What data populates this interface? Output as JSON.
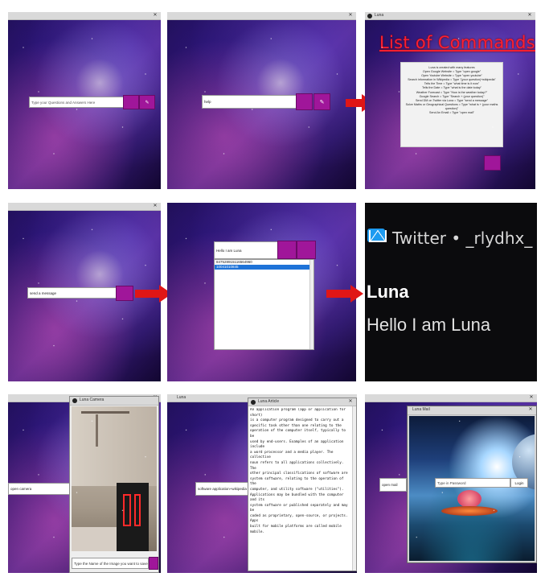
{
  "panel1": {
    "question_input": {
      "placeholder": "Type your Questions and Answers Here"
    }
  },
  "panel2": {
    "question_input": {
      "value": "help"
    }
  },
  "panel3": {
    "window_title": "Luna",
    "commands_title": "List of Commands",
    "commands": [
      "Luna is created with many features",
      "Open Google Website = Type \"open google\"",
      "Open Youtube Website = Type \"open youtube\"",
      "Search information in Wikipedia = Type \"(your question)+wikipedia\"",
      "Tells the Time = Type \"what time is it now\"",
      "Tells the Date = Type \"what is the date today\"",
      "Weather Forecast = Type \"How is the weather today?\"",
      "Google Search = Type \"Search + (your question)\"",
      "Send DM on Twitter via Luna = Type \"send a message\"",
      "Solve Maths or Geographical Questions = Type \"what is + (your maths question)\"",
      "Send An Email = Type \"open mail\""
    ]
  },
  "panel4": {
    "question_input": {
      "value": "send a message"
    }
  },
  "panel5": {
    "message_input": {
      "value": "Hello I am Luna"
    },
    "list_items": [
      "847528915116564960",
      "10041010845"
    ],
    "selected_index": 1
  },
  "panel6": {
    "notification_line": "Twitter • _rlydhx_ • now",
    "sender": "Luna",
    "message": "Hello I am Luna"
  },
  "panel7": {
    "question_input": {
      "value": "open camera"
    },
    "camera_window_title": "Luna Camera",
    "save_input": {
      "placeholder": "Type the Name of the Image you want to save"
    }
  },
  "panel8": {
    "window_title": "Luna",
    "question_input": {
      "value": "software application+wikipedia"
    },
    "wiki_window_title": "Luna Article",
    "wiki_text": "An application program (app or application for short)\nis a computer program designed to carry out a\nspecific task other than one relating to the\noperation of the computer itself, typically to be\nused by end-users. Examples of an application include\na word processor and a media player. The collective\nnoun refers to all applications collectively. The\nother principal classifications of software are\nsystem software, relating to the operation of the\ncomputer, and utility software (\"utilities\").\nApplications may be bundled with the computer and its\nsystem software or published separately and may be\ncoded as proprietary, open-source, or projects. Apps\nbuilt for mobile platforms are called mobile mobile."
  },
  "panel9": {
    "question_input": {
      "value": "open mail"
    },
    "mail_window_title": "Luna Mail",
    "password_input": {
      "placeholder": "Type in Password"
    },
    "login_label": "Login"
  },
  "colors": {
    "button_purple": "#a0169a",
    "arrow_red": "#e01616",
    "title_red": "#ff1f2f",
    "twitter_blue": "#1d9bf0"
  }
}
